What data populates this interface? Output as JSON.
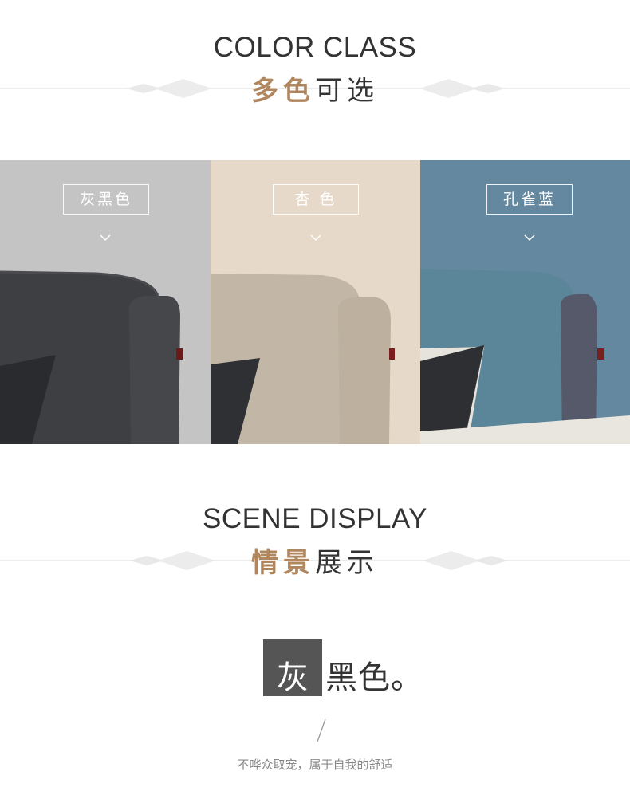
{
  "color_class": {
    "en_title": "COLOR CLASS",
    "cn_accent": "多色",
    "cn_rest": "可选"
  },
  "swatches": [
    {
      "label": "灰黑色",
      "background": "#c4c4c5",
      "fabric": "#3e3f43",
      "icon": "chevron-down-icon"
    },
    {
      "label": "杏 色",
      "background": "#e6d9ca",
      "fabric": "#c2b6a6",
      "icon": "chevron-down-icon"
    },
    {
      "label": "孔雀蓝",
      "background": "#6388a0",
      "fabric": "#5b8598",
      "icon": "chevron-down-icon"
    }
  ],
  "scene_display": {
    "en_title": "SCENE DISPLAY",
    "cn_accent": "情景",
    "cn_rest": "展示"
  },
  "scene": {
    "boxed_char": "灰",
    "rest": "黑色。",
    "tagline": "不哗众取宠，属于自我的舒适"
  },
  "colors": {
    "accent": "#b0865f",
    "heading": "#333333"
  }
}
